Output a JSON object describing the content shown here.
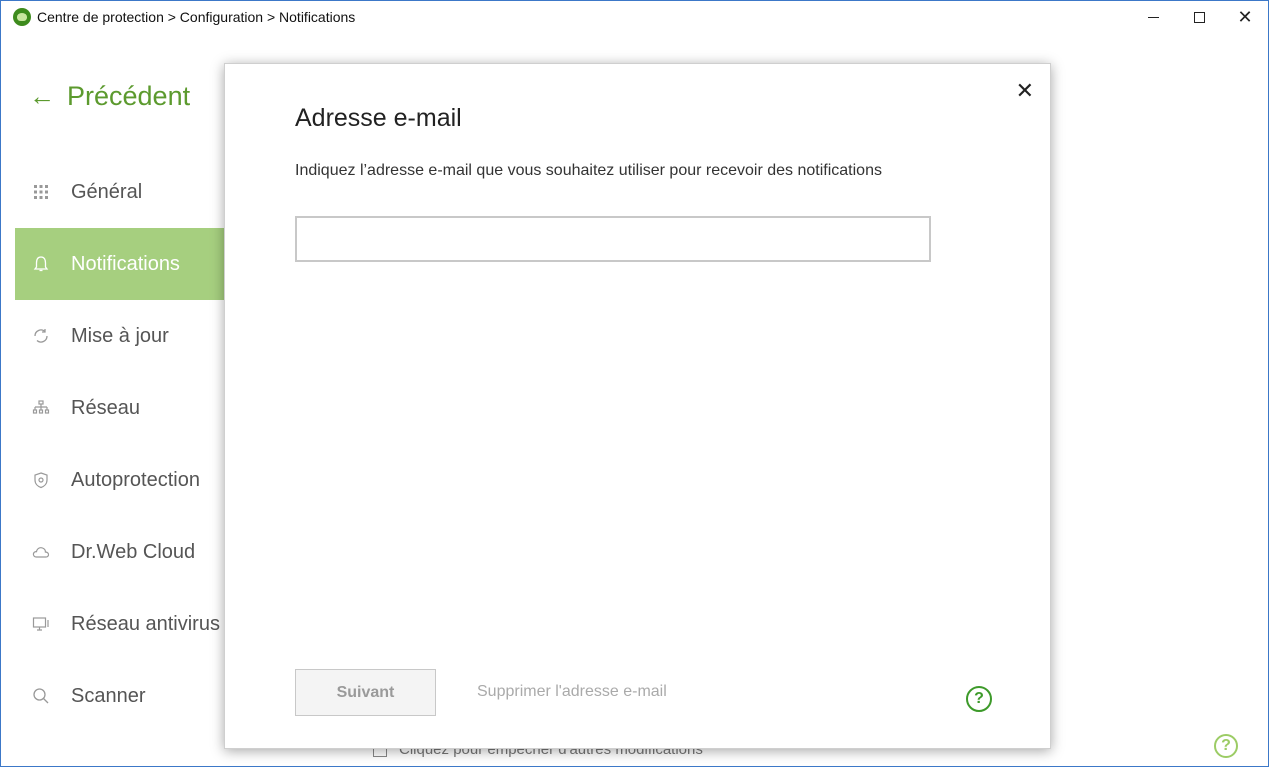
{
  "window": {
    "title": "Centre de protection > Configuration > Notifications",
    "controls": {
      "minimize": "",
      "maximize": "",
      "close": "✕"
    }
  },
  "sidebar": {
    "back_label": "Précédent",
    "items": [
      {
        "label": "Général",
        "icon": "grid-icon",
        "active": false
      },
      {
        "label": "Notifications",
        "icon": "bell-icon",
        "active": true
      },
      {
        "label": "Mise à jour",
        "icon": "refresh-icon",
        "active": false
      },
      {
        "label": "Réseau",
        "icon": "network-icon",
        "active": false
      },
      {
        "label": "Autoprotection",
        "icon": "shield-icon",
        "active": false
      },
      {
        "label": "Dr.Web Cloud",
        "icon": "cloud-icon",
        "active": false
      },
      {
        "label": "Réseau antivirus",
        "icon": "monitor-icon",
        "active": false
      },
      {
        "label": "Scanner",
        "icon": "search-icon",
        "active": false
      }
    ]
  },
  "background": {
    "lock_hint": "Cliquez pour empêcher d'autres modifications",
    "help": "?"
  },
  "dialog": {
    "title": "Adresse e-mail",
    "description": "Indiquez l’adresse e-mail que vous souhaitez utiliser pour recevoir des notifications",
    "email_value": "",
    "email_placeholder": "",
    "next_button": "Suivant",
    "remove_link": "Supprimer l'adresse e-mail",
    "close": "✕",
    "help": "?"
  },
  "colors": {
    "accent_green": "#5c9a2e",
    "active_nav_bg": "#a6cf7f",
    "help_green": "#3d9a2a"
  }
}
